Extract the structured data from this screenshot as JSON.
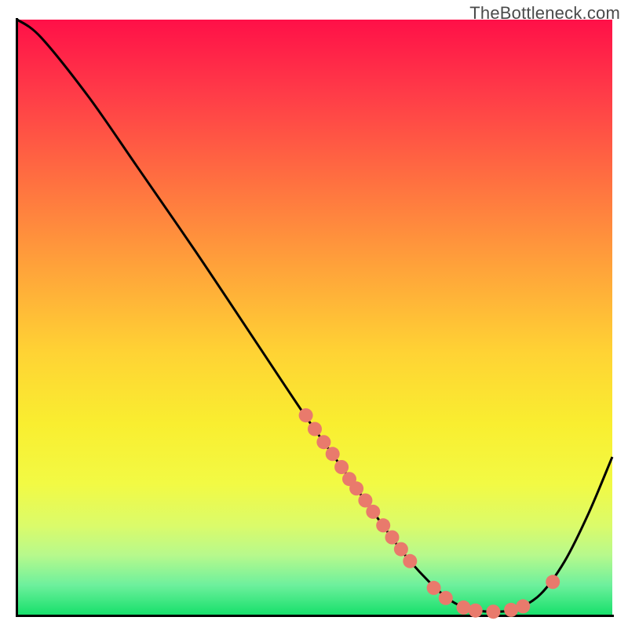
{
  "watermark": "TheBottleneck.com",
  "chart_data": {
    "type": "line",
    "title": "",
    "xlabel": "",
    "ylabel": "",
    "xlim": [
      0,
      1
    ],
    "ylim": [
      0,
      1
    ],
    "curve": [
      {
        "x": 0.0,
        "y": 1.0
      },
      {
        "x": 0.04,
        "y": 0.97
      },
      {
        "x": 0.12,
        "y": 0.87
      },
      {
        "x": 0.2,
        "y": 0.755
      },
      {
        "x": 0.3,
        "y": 0.61
      },
      {
        "x": 0.4,
        "y": 0.46
      },
      {
        "x": 0.48,
        "y": 0.34
      },
      {
        "x": 0.54,
        "y": 0.255
      },
      {
        "x": 0.6,
        "y": 0.17
      },
      {
        "x": 0.66,
        "y": 0.09
      },
      {
        "x": 0.72,
        "y": 0.03
      },
      {
        "x": 0.76,
        "y": 0.01
      },
      {
        "x": 0.8,
        "y": 0.005
      },
      {
        "x": 0.84,
        "y": 0.01
      },
      {
        "x": 0.88,
        "y": 0.035
      },
      {
        "x": 0.92,
        "y": 0.09
      },
      {
        "x": 0.96,
        "y": 0.17
      },
      {
        "x": 1.0,
        "y": 0.265
      }
    ],
    "marker_points": [
      {
        "x": 0.485,
        "y": 0.335
      },
      {
        "x": 0.5,
        "y": 0.312
      },
      {
        "x": 0.515,
        "y": 0.29
      },
      {
        "x": 0.53,
        "y": 0.27
      },
      {
        "x": 0.545,
        "y": 0.248
      },
      {
        "x": 0.558,
        "y": 0.228
      },
      {
        "x": 0.57,
        "y": 0.212
      },
      {
        "x": 0.585,
        "y": 0.192
      },
      {
        "x": 0.598,
        "y": 0.173
      },
      {
        "x": 0.615,
        "y": 0.15
      },
      {
        "x": 0.63,
        "y": 0.13
      },
      {
        "x": 0.645,
        "y": 0.11
      },
      {
        "x": 0.66,
        "y": 0.09
      },
      {
        "x": 0.7,
        "y": 0.045
      },
      {
        "x": 0.72,
        "y": 0.028
      },
      {
        "x": 0.75,
        "y": 0.012
      },
      {
        "x": 0.77,
        "y": 0.007
      },
      {
        "x": 0.8,
        "y": 0.005
      },
      {
        "x": 0.83,
        "y": 0.008
      },
      {
        "x": 0.85,
        "y": 0.014
      },
      {
        "x": 0.9,
        "y": 0.055
      }
    ],
    "colors": {
      "curve_stroke": "#000000",
      "marker_fill": "#e97a6c",
      "gradient_top": "#ff1048",
      "gradient_bottom": "#17e06b"
    }
  }
}
